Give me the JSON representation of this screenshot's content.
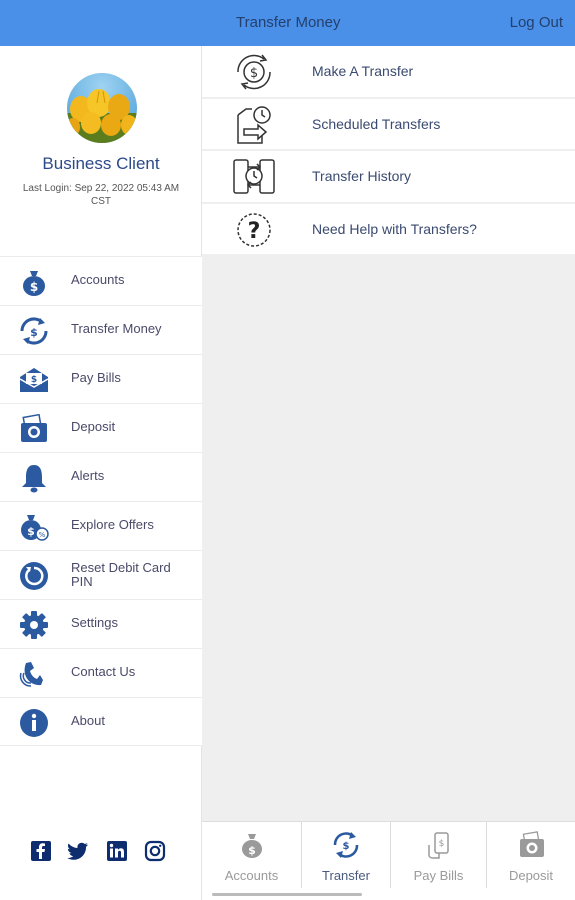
{
  "colors": {
    "header_bg": "#4a8fe8",
    "header_text": "#24406e",
    "primary_blue": "#2c5aa0",
    "content_bg": "#efefef"
  },
  "header": {
    "title": "Transfer Money",
    "logout_label": "Log Out"
  },
  "profile": {
    "name": "Business Client",
    "last_login": "Last Login: Sep 22, 2022 05:43 AM CST",
    "avatar_icon": "yellow-tulips-photo"
  },
  "sidebar": {
    "items": [
      {
        "label": "Accounts",
        "icon": "money-bag-icon"
      },
      {
        "label": "Transfer Money",
        "icon": "transfer-icon"
      },
      {
        "label": "Pay Bills",
        "icon": "envelope-dollar-icon"
      },
      {
        "label": "Deposit",
        "icon": "camera-check-icon"
      },
      {
        "label": "Alerts",
        "icon": "bell-icon"
      },
      {
        "label": "Explore Offers",
        "icon": "offers-bag-icon"
      },
      {
        "label": "Reset Debit Card PIN",
        "icon": "reset-icon"
      },
      {
        "label": "Settings",
        "icon": "gear-icon"
      },
      {
        "label": "Contact Us",
        "icon": "phone-icon"
      },
      {
        "label": "About",
        "icon": "info-icon"
      }
    ]
  },
  "social": {
    "items": [
      "facebook-icon",
      "twitter-icon",
      "linkedin-icon",
      "instagram-icon"
    ]
  },
  "transfer_menu": {
    "items": [
      {
        "label": "Make A Transfer",
        "icon": "dollar-cycle-icon"
      },
      {
        "label": "Scheduled Transfers",
        "icon": "scheduled-transfer-icon"
      },
      {
        "label": "Transfer History",
        "icon": "transfer-history-icon"
      },
      {
        "label": "Need Help with Transfers?",
        "icon": "question-icon"
      }
    ]
  },
  "bottom_nav": {
    "items": [
      {
        "label": "Accounts",
        "icon": "money-bag-icon",
        "active": false
      },
      {
        "label": "Transfer",
        "icon": "transfer-icon",
        "active": true
      },
      {
        "label": "Pay Bills",
        "icon": "phone-bill-icon",
        "active": false
      },
      {
        "label": "Deposit",
        "icon": "camera-check-icon",
        "active": false
      }
    ]
  }
}
